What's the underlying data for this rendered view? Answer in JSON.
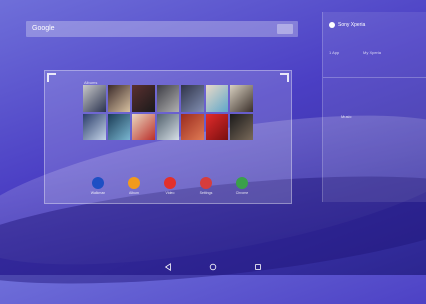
{
  "search": {
    "label": "Google"
  },
  "widget": {
    "header": "Albums",
    "albums": [
      "a1",
      "a2",
      "a3",
      "a4",
      "a5",
      "a6",
      "a7",
      "a8",
      "a9",
      "a10",
      "a11",
      "a12",
      "a13",
      "a14"
    ],
    "apps": [
      {
        "icon": "walkman-icon",
        "label": "Walkman",
        "color": "#1e4fc4"
      },
      {
        "icon": "album-icon",
        "label": "Album",
        "color": "#f29a1d"
      },
      {
        "icon": "video-icon",
        "label": "Video",
        "color": "#e2302b"
      },
      {
        "icon": "settings-icon",
        "label": "Settings",
        "color": "#d63d3d"
      },
      {
        "icon": "chrome-icon",
        "label": "Chrome",
        "color": "#3aa04a"
      }
    ]
  },
  "right_panel": {
    "title": "Sony Xperia",
    "tabs": [
      "1 App",
      "My Xperia"
    ],
    "item": "Music"
  },
  "navbar": {
    "back_icon": "back-icon",
    "home_icon": "home-icon",
    "recents_icon": "recents-icon"
  }
}
